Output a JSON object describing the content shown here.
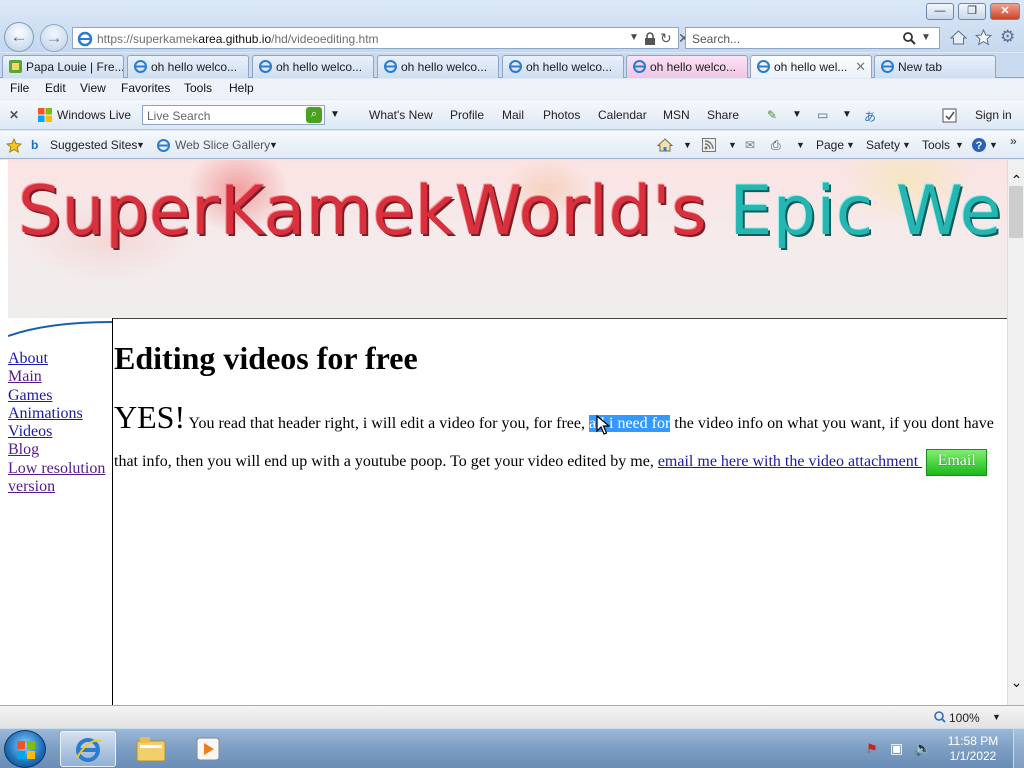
{
  "browser": {
    "address_base": "https://superkamek",
    "address_host": "area.github.io",
    "address_path": "/hd/videoediting.htm",
    "search_placeholder": "Search...",
    "tabs": [
      {
        "label": "Papa Louie | Fre..."
      },
      {
        "label": "oh hello welco..."
      },
      {
        "label": "oh hello welco..."
      },
      {
        "label": "oh hello welco..."
      },
      {
        "label": "oh hello welco..."
      },
      {
        "label": "oh hello welco..."
      },
      {
        "label": "oh hello wel...",
        "close": "✕"
      },
      {
        "label": "New tab"
      }
    ],
    "menu": [
      "File",
      "Edit",
      "View",
      "Favorites",
      "Tools",
      "Help"
    ],
    "windows_live": {
      "close": "✕",
      "brand": "Windows Live",
      "search_placeholder": "Live Search",
      "links": [
        "What's New",
        "Profile",
        "Mail",
        "Photos",
        "Calendar",
        "MSN",
        "Share"
      ],
      "sign_in": "Sign in"
    },
    "favorites": {
      "suggested": "Suggested Sites",
      "web_slice": "Web Slice Gallery",
      "commands": [
        "Page",
        "Safety",
        "Tools"
      ]
    },
    "status": {
      "zoom": "100%"
    }
  },
  "page": {
    "banner_left": "SuperKamekWorld's ",
    "banner_right": "Epic Website!",
    "sidebar": [
      {
        "label": "About",
        "visited": false
      },
      {
        "label": "Main",
        "visited": true
      },
      {
        "label": "Games",
        "visited": false
      },
      {
        "label": "Animations",
        "visited": false
      },
      {
        "label": "Videos",
        "visited": false
      },
      {
        "label": "Blog",
        "visited": true
      },
      {
        "label": "Low resolution version",
        "visited": true
      }
    ],
    "heading": "Editing videos for free",
    "para_big": "YES!",
    "para_before": " You read that header right, i will edit a video for you, for free, ",
    "para_selected": "all i need for",
    "para_after": " the video info on what you want, if you dont have that info, then you will end up with a youtube poop. To get your video edited by me, ",
    "email_link": "email me here with the video attachment ",
    "email_button": "Email"
  },
  "taskbar": {
    "time": "11:58 PM",
    "date": "1/1/2022"
  }
}
